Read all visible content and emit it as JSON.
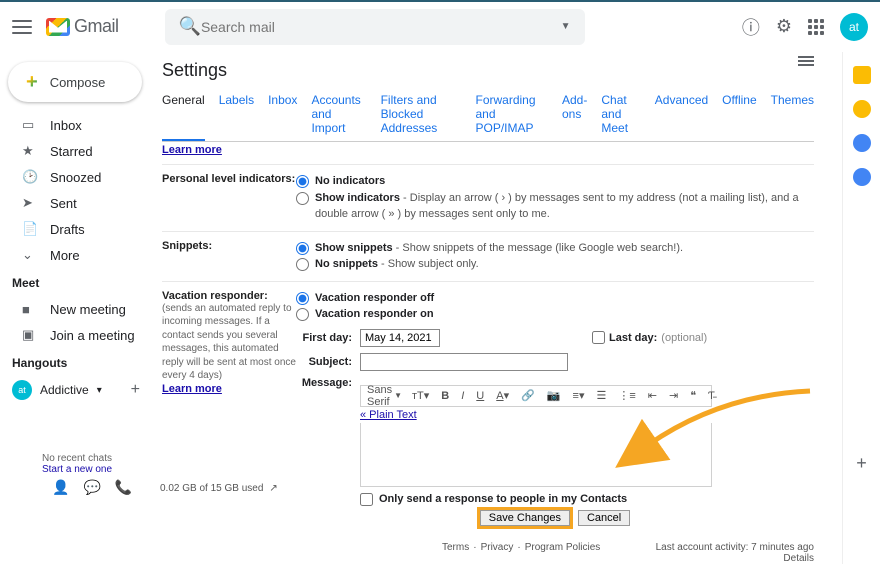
{
  "header": {
    "product": "Gmail",
    "search_placeholder": "Search mail",
    "avatar_initials": "at"
  },
  "compose_label": "Compose",
  "nav": {
    "inbox": "Inbox",
    "starred": "Starred",
    "snoozed": "Snoozed",
    "sent": "Sent",
    "drafts": "Drafts",
    "more": "More"
  },
  "meet": {
    "heading": "Meet",
    "new_meeting": "New meeting",
    "join_meeting": "Join a meeting"
  },
  "hangouts": {
    "heading": "Hangouts",
    "name": "Addictive",
    "no_chats": "No recent chats",
    "start_new": "Start a new one"
  },
  "settings": {
    "title": "Settings",
    "tabs": {
      "general": "General",
      "labels": "Labels",
      "inbox": "Inbox",
      "accounts": "Accounts and Import",
      "filters": "Filters and Blocked Addresses",
      "forwarding": "Forwarding and POP/IMAP",
      "addons": "Add-ons",
      "chat": "Chat and Meet",
      "advanced": "Advanced",
      "offline": "Offline",
      "themes": "Themes"
    },
    "learn_more": "Learn more",
    "pli": {
      "label": "Personal level indicators:",
      "no": "No indicators",
      "show": "Show indicators",
      "show_desc": " - Display an arrow ( › ) by messages sent to my address (not a mailing list), and a double arrow ( » ) by messages sent only to me."
    },
    "snippets": {
      "label": "Snippets:",
      "show": "Show snippets",
      "show_desc": " - Show snippets of the message (like Google web search!).",
      "no": "No snippets",
      "no_desc": " - Show subject only."
    },
    "vacation": {
      "label": "Vacation responder:",
      "sub": "(sends an automated reply to incoming messages. If a contact sends you several messages, this automated reply will be sent at most once every 4 days)",
      "off": "Vacation responder off",
      "on": "Vacation responder on",
      "first_day_label": "First day:",
      "first_day_value": "May 14, 2021",
      "last_day_label": "Last day:",
      "last_day_hint": "(optional)",
      "subject_label": "Subject:",
      "message_label": "Message:",
      "font": "Sans Serif",
      "plain_text": "« Plain Text",
      "only_contacts": "Only send a response to people in my Contacts"
    },
    "save": "Save Changes",
    "cancel": "Cancel"
  },
  "footer": {
    "terms": "Terms",
    "privacy": "Privacy",
    "policies": "Program Policies",
    "activity": "Last account activity: 7 minutes ago",
    "details": "Details",
    "storage": "0.02 GB of 15 GB used"
  }
}
